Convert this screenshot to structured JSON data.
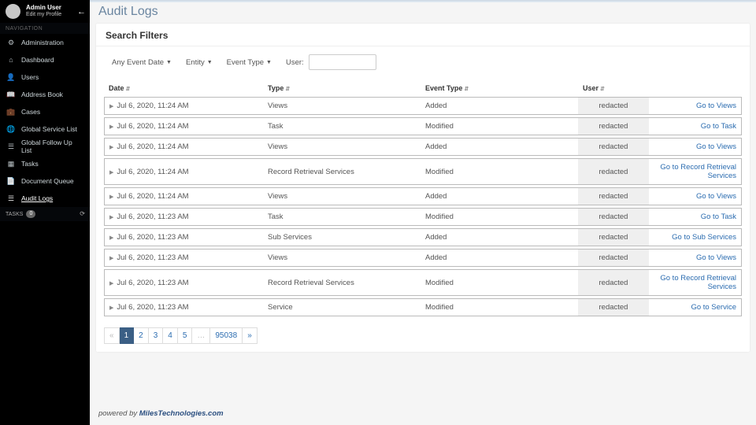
{
  "user": {
    "name": "Admin User",
    "edit": "Edit my Profile"
  },
  "nav": {
    "header": "NAVIGATION",
    "items": [
      {
        "icon": "⚙",
        "label": "Administration",
        "name": "nav-administration"
      },
      {
        "icon": "⌂",
        "label": "Dashboard",
        "name": "nav-dashboard"
      },
      {
        "icon": "👤",
        "label": "Users",
        "name": "nav-users"
      },
      {
        "icon": "📖",
        "label": "Address Book",
        "name": "nav-address-book"
      },
      {
        "icon": "💼",
        "label": "Cases",
        "name": "nav-cases"
      },
      {
        "icon": "🌐",
        "label": "Global Service List",
        "name": "nav-global-service-list"
      },
      {
        "icon": "☰",
        "label": "Global Follow Up List",
        "name": "nav-global-follow-up"
      },
      {
        "icon": "▦",
        "label": "Tasks",
        "name": "nav-tasks"
      },
      {
        "icon": "📄",
        "label": "Document Queue",
        "name": "nav-document-queue"
      },
      {
        "icon": "☰",
        "label": "Audit Logs",
        "name": "nav-audit-logs",
        "active": true
      }
    ],
    "tasks_label": "TASKS",
    "tasks_badge": "0"
  },
  "page": {
    "title": "Audit Logs"
  },
  "filters": {
    "title": "Search Filters",
    "date": "Any Event Date",
    "entity": "Entity",
    "event_type": "Event Type",
    "user_label": "User:"
  },
  "columns": {
    "date": "Date",
    "type": "Type",
    "event_type": "Event Type",
    "user": "User"
  },
  "rows": [
    {
      "date": "Jul 6, 2020, 11:24 AM",
      "type": "Views",
      "event": "Added",
      "user": "redacted",
      "link": "Go to Views",
      "link_name": "views"
    },
    {
      "date": "Jul 6, 2020, 11:24 AM",
      "type": "Task",
      "event": "Modified",
      "user": "redacted",
      "link": "Go to Task",
      "link_name": "task"
    },
    {
      "date": "Jul 6, 2020, 11:24 AM",
      "type": "Views",
      "event": "Added",
      "user": "redacted",
      "link": "Go to Views",
      "link_name": "views"
    },
    {
      "date": "Jul 6, 2020, 11:24 AM",
      "type": "Record Retrieval Services",
      "event": "Modified",
      "user": "redacted",
      "link": "Go to Record Retrieval Services",
      "link_name": "record-retrieval-services"
    },
    {
      "date": "Jul 6, 2020, 11:24 AM",
      "type": "Views",
      "event": "Added",
      "user": "redacted",
      "link": "Go to Views",
      "link_name": "views"
    },
    {
      "date": "Jul 6, 2020, 11:23 AM",
      "type": "Task",
      "event": "Modified",
      "user": "redacted",
      "link": "Go to Task",
      "link_name": "task"
    },
    {
      "date": "Jul 6, 2020, 11:23 AM",
      "type": "Sub Services",
      "event": "Added",
      "user": "redacted",
      "link": "Go to Sub Services",
      "link_name": "sub-services"
    },
    {
      "date": "Jul 6, 2020, 11:23 AM",
      "type": "Views",
      "event": "Added",
      "user": "redacted",
      "link": "Go to Views",
      "link_name": "views"
    },
    {
      "date": "Jul 6, 2020, 11:23 AM",
      "type": "Record Retrieval Services",
      "event": "Modified",
      "user": "redacted",
      "link": "Go to Record Retrieval Services",
      "link_name": "record-retrieval-services"
    },
    {
      "date": "Jul 6, 2020, 11:23 AM",
      "type": "Service",
      "event": "Modified",
      "user": "redacted",
      "link": "Go to Service",
      "link_name": "service"
    }
  ],
  "pagination": {
    "prev": "«",
    "next": "»",
    "ellipsis": "…",
    "pages": [
      "1",
      "2",
      "3",
      "4",
      "5"
    ],
    "last": "95038",
    "active": "1"
  },
  "footer": {
    "prefix": "powered by ",
    "brand": "MilesTechnologies.com"
  }
}
